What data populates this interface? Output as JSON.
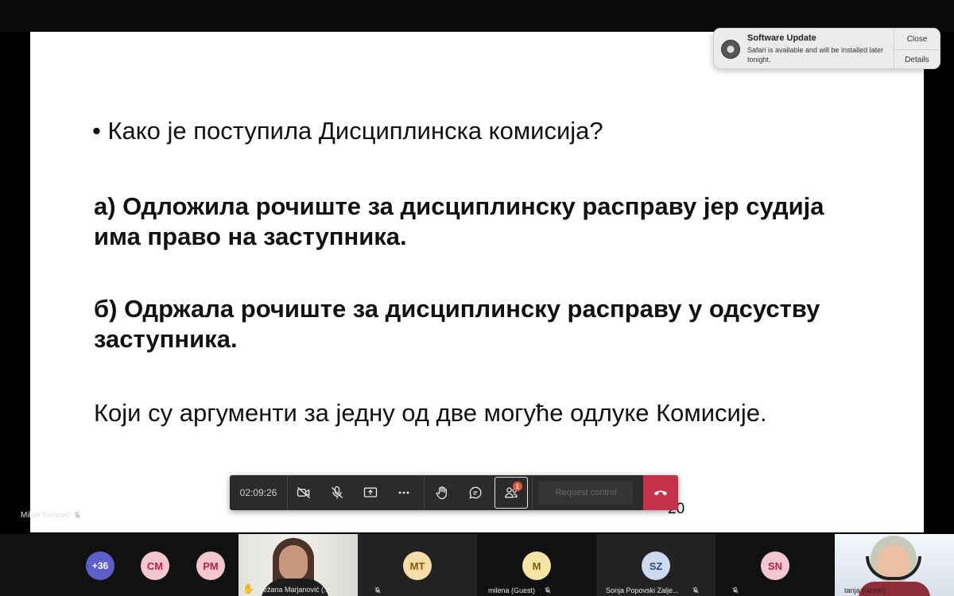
{
  "slide": {
    "question": "• Како је поступила Дисциплинска комисија?",
    "option_a": "а) Одложила рочиште за дисциплинску расправу јер судија има право на заступника.",
    "option_b": "б) Одржала рочиште за дисциплинску расправу у одсуству заступника.",
    "arguments": "Који су аргументи за једну од две могуће одлуке Комисије.",
    "page_number": "20"
  },
  "notification": {
    "title": "Software Update",
    "message": "Safari is available and will be installed later tonight.",
    "close_label": "Close",
    "details_label": "Details",
    "icon": "software-update-gear-icon"
  },
  "toolbar": {
    "timer": "02:09:26",
    "participants_badge": "1",
    "request_control_label": "Request control",
    "icons": [
      "camera-off-icon",
      "mic-off-icon",
      "share-screen-icon",
      "more-options-icon",
      "raise-hand-icon",
      "chat-icon",
      "participants-icon",
      "hang-up-icon"
    ],
    "hangup_color": "#c4314b"
  },
  "presenter": {
    "name": "Milan Tomović"
  },
  "participants": {
    "overflow": "+36",
    "avatars": [
      {
        "initials": "CM",
        "bg": "#f4c7d0",
        "fg": "#b4244b"
      },
      {
        "initials": "PM",
        "bg": "#f4c7d0",
        "fg": "#b4244b"
      },
      {
        "initials": "MT",
        "bg": "#f6dcaa",
        "fg": "#8a5a00"
      },
      {
        "initials": "M",
        "bg": "#f6e3a6",
        "fg": "#7a5c00"
      },
      {
        "initials": "SZ",
        "bg": "#cdd9ef",
        "fg": "#2b4a86"
      },
      {
        "initials": "SN",
        "bg": "#f4c7d0",
        "fg": "#b4244b"
      }
    ],
    "names": {
      "snezana": "Snežana Marjanović (...",
      "milena": "milena (Guest)",
      "sonja": "Sonja Popovski Zalje...",
      "tanja": "tanja (Guest)"
    }
  }
}
